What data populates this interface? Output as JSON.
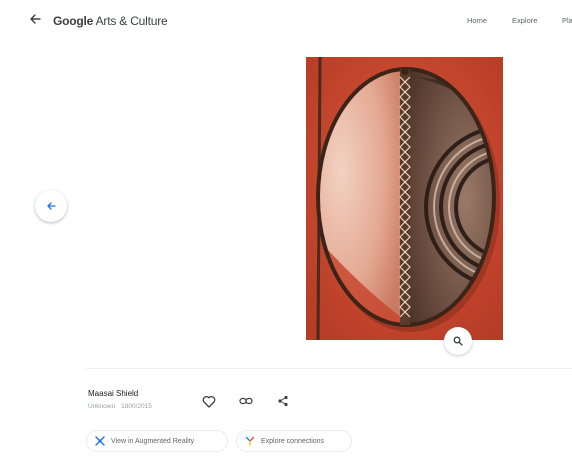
{
  "header": {
    "brand_google": "Google",
    "brand_rest": " Arts & Culture",
    "nav": [
      "Home",
      "Explore",
      "Pla"
    ]
  },
  "artwork": {
    "title": "Maasai Shield",
    "creator": "Unknown",
    "date": "1800/2015"
  },
  "chips": {
    "ar_label": "View in Augmented Reality",
    "connections_label": "Explore connections"
  },
  "colors": {
    "accent": "#1a73e8",
    "artwork_background": "#c8472e"
  },
  "icons": [
    "back-arrow-icon",
    "previous-arrow-icon",
    "zoom-icon",
    "heart-icon",
    "link-icon",
    "share-icon",
    "augmented-reality-icon",
    "connections-icon"
  ]
}
